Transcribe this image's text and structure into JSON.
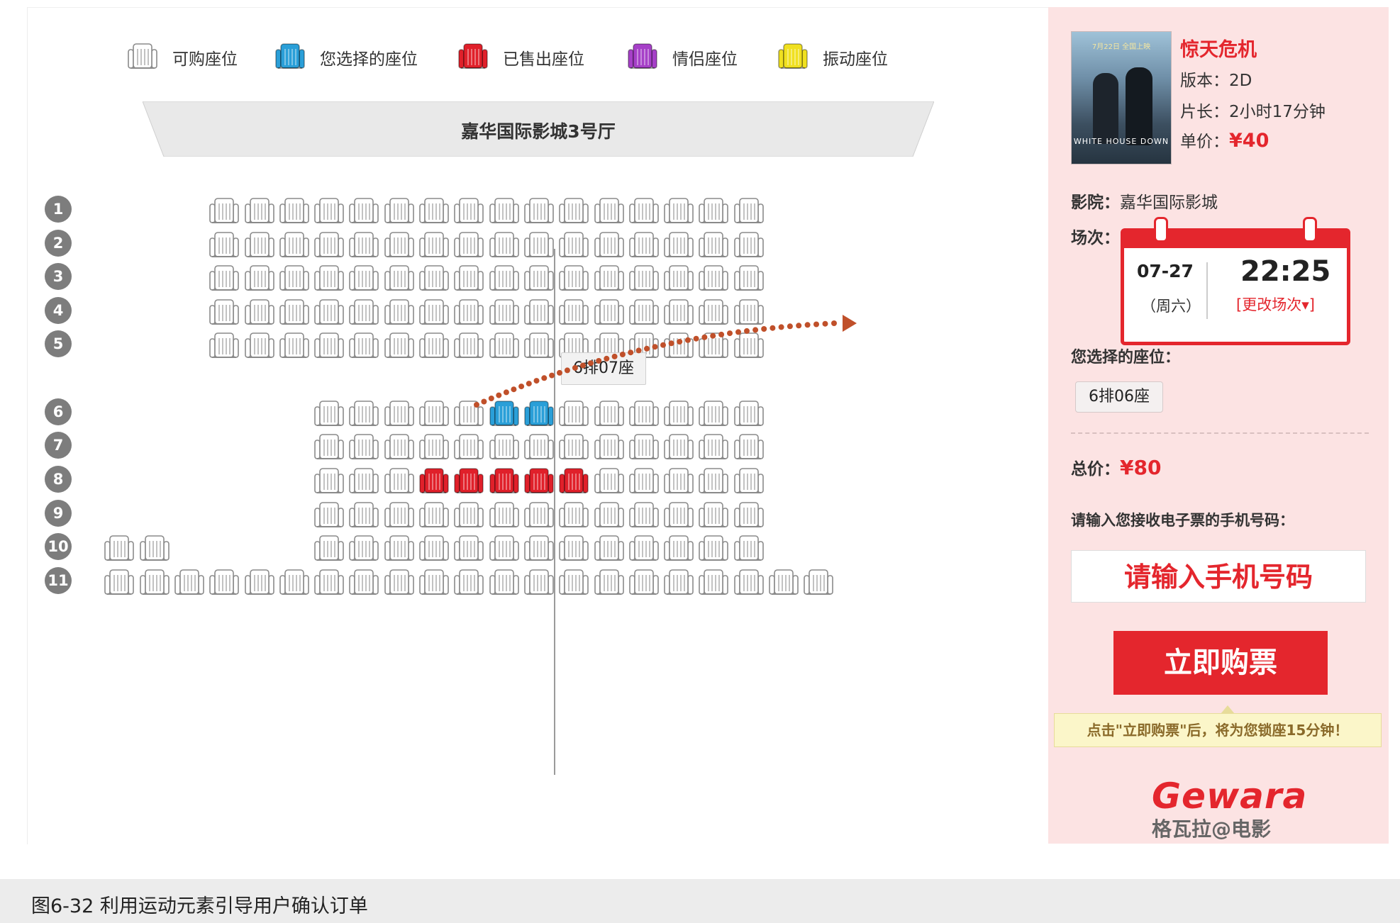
{
  "legend": {
    "items": [
      {
        "label": "可购座位",
        "type": "available"
      },
      {
        "label": "您选择的座位",
        "type": "selected"
      },
      {
        "label": "已售出座位",
        "type": "sold"
      },
      {
        "label": "情侣座位",
        "type": "couple"
      },
      {
        "label": "振动座位",
        "type": "vibration"
      }
    ]
  },
  "screen": {
    "label": "嘉华国际影城3号厅"
  },
  "seat_colors": {
    "available": "#ffffff",
    "selected": "#2a9fd8",
    "sold": "#e0202a",
    "couple": "#a640c8",
    "vibration": "#f0e020"
  },
  "seat_map": {
    "rows": [
      {
        "label": "1",
        "seats": "----XXXXXXXXXXXXXXXX"
      },
      {
        "label": "2",
        "seats": "----XXXXXXXXXXXXXXXX"
      },
      {
        "label": "3",
        "seats": "----XXXXXXXXXXXXXXXX"
      },
      {
        "label": "4",
        "seats": "----XXXXXXXXXXXXXXXX"
      },
      {
        "label": "5",
        "seats": "----XXXXXXXXXXXXXXXX"
      },
      {
        "label": "6",
        "seats": "-------XXXXXSSXXXXXX"
      },
      {
        "label": "7",
        "seats": "-------XXXXXXXXXXXXX"
      },
      {
        "label": "8",
        "seats": "-------XXXRRRRRXXXXX"
      },
      {
        "label": "9",
        "seats": "-------XXXXXXXXXXXXX"
      },
      {
        "label": "10",
        "seats": "-XX----XXXXXXXXXXXXX"
      },
      {
        "label": "11",
        "seats": "-XXXXXXXXXXXXXXXXXXXXX"
      }
    ]
  },
  "hover_tip": "6排07座",
  "movie": {
    "title": "惊天危机",
    "version_label": "版本：",
    "version": "2D",
    "duration_label": "片长：",
    "duration": "2小时17分钟",
    "price_label": "单价：",
    "price": "¥40",
    "poster_tagline": "7月22日  全国上映",
    "poster_title": "WHITE HOUSE DOWN"
  },
  "cinema": {
    "label": "影院：",
    "name": "嘉华国际影城"
  },
  "showtime": {
    "label": "场次：",
    "date": "07-27",
    "weekday": "（周六）",
    "time": "22:25",
    "change": "[更改场次▾]"
  },
  "selected_seats": {
    "label": "您选择的座位：",
    "seat": "6排06座"
  },
  "total": {
    "label": "总价：",
    "value": "¥80"
  },
  "phone": {
    "label": "请输入您接收电子票的手机号码：",
    "placeholder": "请输入手机号码"
  },
  "buy_button": "立即购票",
  "lock_tip": "点击\"立即购票\"后，将为您锁座15分钟！",
  "logo": {
    "en": "Gewara",
    "cn": "格瓦拉@电影"
  },
  "caption": "图6-32 利用运动元素引导用户确认订单"
}
